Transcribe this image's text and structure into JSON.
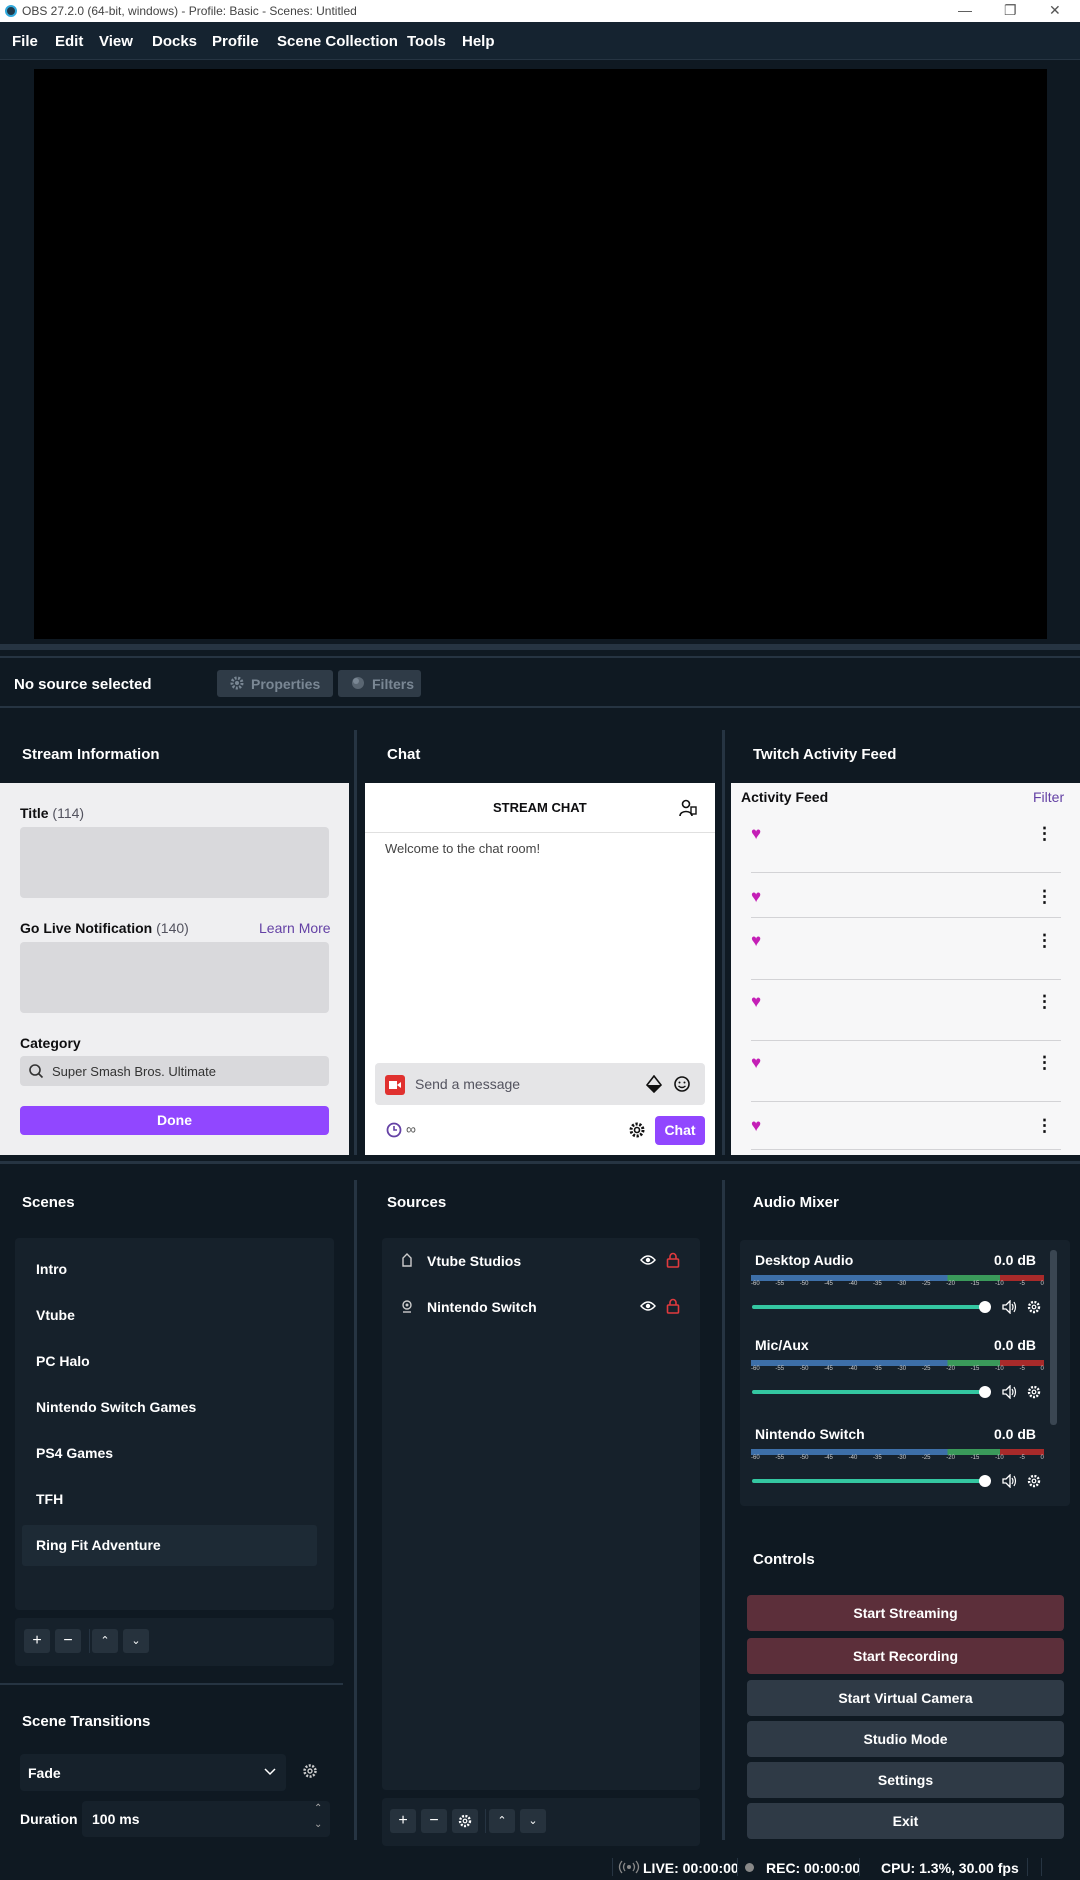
{
  "window": {
    "title": "OBS 27.2.0 (64-bit, windows) - Profile: Basic - Scenes: Untitled",
    "minimize": "—",
    "maximize": "❐",
    "close": "✕"
  },
  "menu": [
    "File",
    "Edit",
    "View",
    "Docks",
    "Profile",
    "Scene Collection",
    "Tools",
    "Help"
  ],
  "source_bar": {
    "status": "No source selected",
    "properties": "Properties",
    "filters": "Filters"
  },
  "stream_info": {
    "dock_title": "Stream Information",
    "title_label": "Title",
    "title_count": "(114)",
    "notif_label": "Go Live Notification",
    "notif_count": "(140)",
    "learn_more": "Learn More",
    "category_label": "Category",
    "category_value": "Super Smash Bros. Ultimate",
    "done": "Done"
  },
  "chat": {
    "dock_title": "Chat",
    "header": "STREAM CHAT",
    "welcome": "Welcome to the chat room!",
    "placeholder": "Send a message",
    "infinity": "∞",
    "chat_button": "Chat"
  },
  "activity": {
    "dock_title": "Twitch Activity Feed",
    "header": "Activity Feed",
    "filter": "Filter"
  },
  "scenes": {
    "dock_title": "Scenes",
    "items": [
      "Intro",
      "Vtube",
      "PC Halo",
      "Nintendo Switch Games",
      "PS4 Games",
      "TFH",
      "Ring Fit Adventure"
    ],
    "selected": "Ring Fit Adventure"
  },
  "sources": {
    "dock_title": "Sources",
    "items": [
      "Vtube Studios",
      "Nintendo Switch"
    ]
  },
  "transitions": {
    "dock_title": "Scene Transitions",
    "type": "Fade",
    "duration_label": "Duration",
    "duration_value": "100 ms"
  },
  "mixer": {
    "dock_title": "Audio Mixer",
    "ticks": [
      "-60",
      "-55",
      "-50",
      "-45",
      "-40",
      "-35",
      "-30",
      "-25",
      "-20",
      "-15",
      "-10",
      "-5",
      "0"
    ],
    "channels": [
      {
        "name": "Desktop Audio",
        "db": "0.0 dB",
        "volume": 1.0
      },
      {
        "name": "Mic/Aux",
        "db": "0.0 dB",
        "volume": 1.0
      },
      {
        "name": "Nintendo Switch",
        "db": "0.0 dB",
        "volume": 1.0
      }
    ]
  },
  "controls": {
    "dock_title": "Controls",
    "start_streaming": "Start Streaming",
    "start_recording": "Start Recording",
    "virtual_camera": "Start Virtual Camera",
    "studio_mode": "Studio Mode",
    "settings": "Settings",
    "exit": "Exit"
  },
  "status": {
    "live": "LIVE: 00:00:00",
    "rec": "REC: 00:00:00",
    "cpu": "CPU: 1.3%, 30.00 fps"
  },
  "colors": {
    "accent_purple": "#9147ff",
    "bg_dark": "#0f1922",
    "panel_dark": "#16212b",
    "record_red": "#5c2f3a",
    "slider_green": "#34c7a1",
    "heart_pink": "#c41fb6"
  }
}
